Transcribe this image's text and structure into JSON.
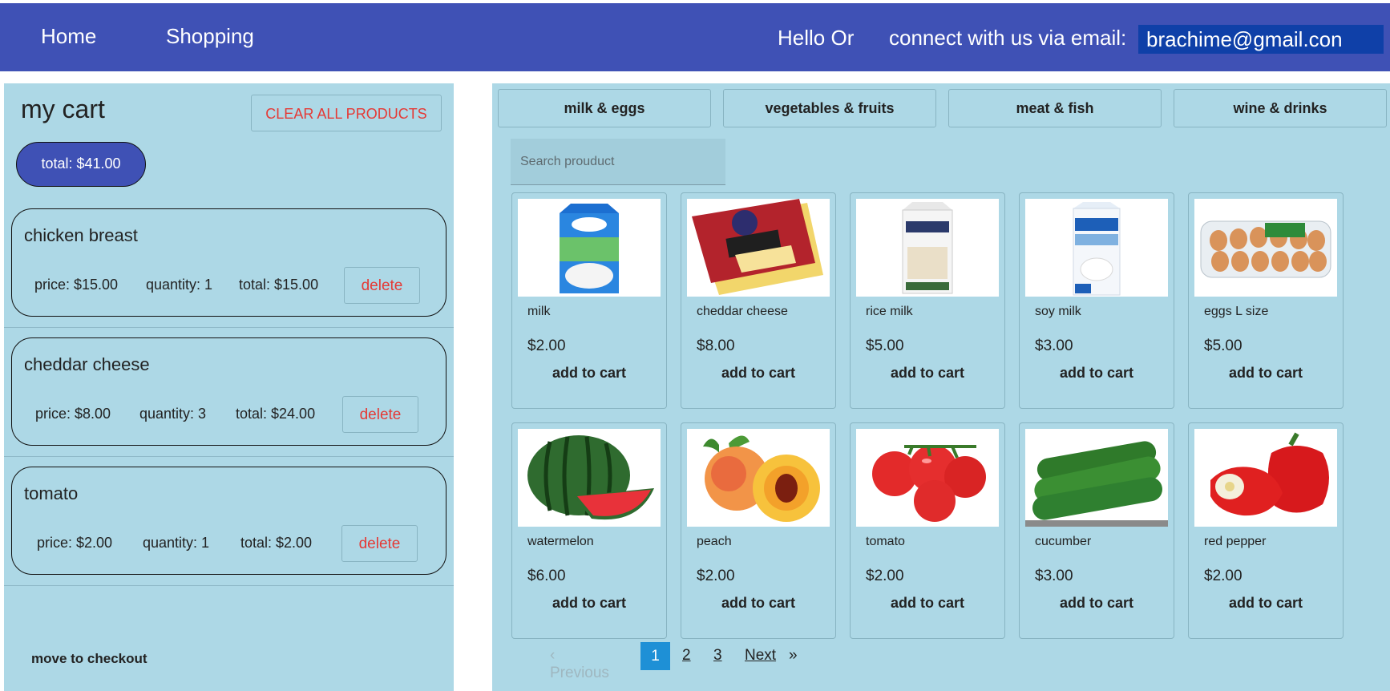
{
  "header": {
    "nav": [
      "Home",
      "Shopping"
    ],
    "greeting": "Hello Or",
    "contact_text": "connect with us via email:",
    "email": "brachime@gmail.con"
  },
  "cart": {
    "title": "my cart",
    "clear_label": "CLEAR ALL PRODUCTS",
    "total_label": "total: $41.00",
    "checkout_label": "move to checkout",
    "items": [
      {
        "name": "chicken breast",
        "price": "price: $15.00",
        "quantity": "quantity: 1",
        "total": "total: $15.00",
        "delete": "delete"
      },
      {
        "name": "cheddar cheese",
        "price": "price: $8.00",
        "quantity": "quantity: 3",
        "total": "total: $24.00",
        "delete": "delete"
      },
      {
        "name": "tomato",
        "price": "price: $2.00",
        "quantity": "quantity: 1",
        "total": "total: $2.00",
        "delete": "delete"
      }
    ]
  },
  "shop": {
    "categories": [
      "milk & eggs",
      "vegetables & fruits",
      "meat & fish",
      "wine & drinks"
    ],
    "search_placeholder": "Search prouduct",
    "add_label": "add to cart",
    "products": [
      {
        "name": "milk",
        "price": "$2.00",
        "icon": "milk-carton-image"
      },
      {
        "name": "cheddar cheese",
        "price": "$8.00",
        "icon": "cheese-package-image"
      },
      {
        "name": "rice milk",
        "price": "$5.00",
        "icon": "rice-milk-carton-image"
      },
      {
        "name": "soy milk",
        "price": "$3.00",
        "icon": "soy-milk-carton-image"
      },
      {
        "name": "eggs L size",
        "price": "$5.00",
        "icon": "egg-carton-image"
      },
      {
        "name": "watermelon",
        "price": "$6.00",
        "icon": "watermelon-image"
      },
      {
        "name": "peach",
        "price": "$2.00",
        "icon": "peach-image"
      },
      {
        "name": "tomato",
        "price": "$2.00",
        "icon": "tomato-image"
      },
      {
        "name": "cucumber",
        "price": "$3.00",
        "icon": "cucumber-image"
      },
      {
        "name": "red pepper",
        "price": "$2.00",
        "icon": "red-pepper-image"
      }
    ],
    "pagination": {
      "previous": "‹ Previous",
      "pages": [
        "1",
        "2",
        "3"
      ],
      "current": "1",
      "next": "Next",
      "next_arrow": "»"
    }
  },
  "colors": {
    "header": "#3f51b5",
    "panel": "#add8e6",
    "danger": "#e53935",
    "active_page": "#1e90d6"
  }
}
